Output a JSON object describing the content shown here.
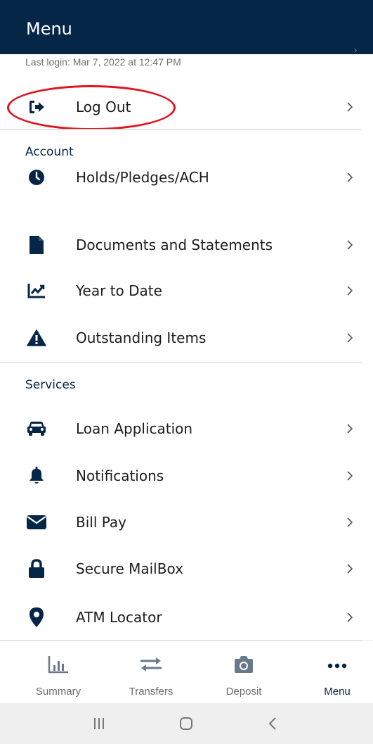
{
  "header": {
    "title": "Menu"
  },
  "last_login": "Last login: Mar 7, 2022 at 12:47 PM",
  "logout": {
    "label": "Log Out",
    "icon": "sign-out-icon"
  },
  "account": {
    "title": "Account",
    "items": [
      {
        "label": "Holds/Pledges/ACH",
        "icon": "clock-icon"
      },
      {
        "label": "Documents and Statements",
        "icon": "document-icon"
      },
      {
        "label": "Year to Date",
        "icon": "line-chart-icon"
      },
      {
        "label": "Outstanding Items",
        "icon": "warning-icon"
      }
    ]
  },
  "services": {
    "title": "Services",
    "items": [
      {
        "label": "Loan Application",
        "icon": "car-icon"
      },
      {
        "label": "Notifications",
        "icon": "bell-icon"
      },
      {
        "label": "Bill Pay",
        "icon": "envelope-icon"
      },
      {
        "label": "Secure MailBox",
        "icon": "lock-icon"
      },
      {
        "label": "ATM Locator",
        "icon": "map-pin-icon"
      }
    ]
  },
  "bottom_nav": {
    "tabs": [
      {
        "label": "Summary",
        "icon": "bar-chart-icon",
        "active": false
      },
      {
        "label": "Transfers",
        "icon": "transfer-arrows-icon",
        "active": false
      },
      {
        "label": "Deposit",
        "icon": "camera-icon",
        "active": false
      },
      {
        "label": "Menu",
        "icon": "more-dots-icon",
        "active": true
      }
    ]
  },
  "colors": {
    "brand": "#062647",
    "annotation": "#e0141c",
    "divider": "#e3e3e3"
  }
}
